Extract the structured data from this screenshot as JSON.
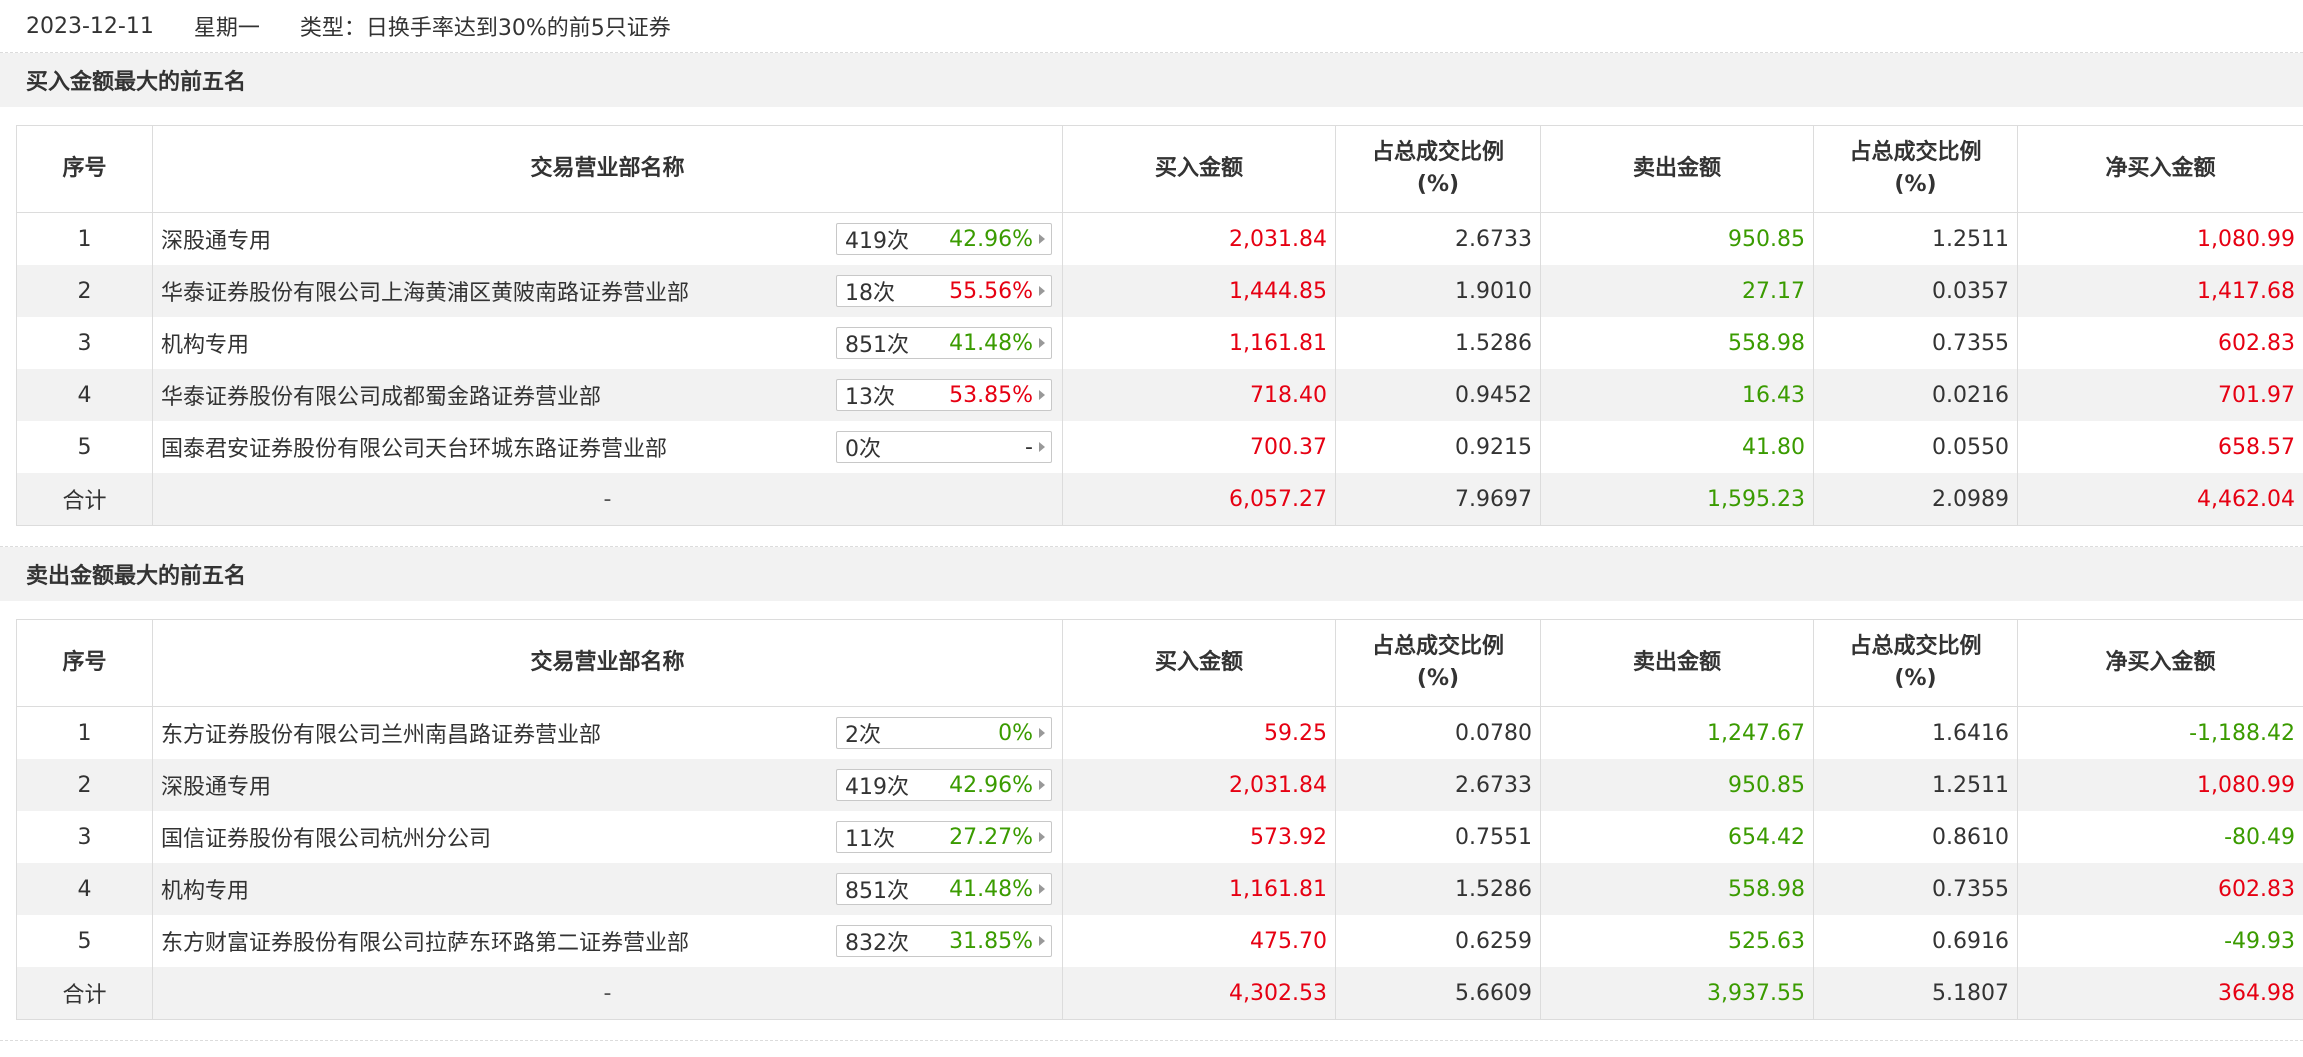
{
  "header": {
    "date": "2023-12-11",
    "weekday": "星期一",
    "type": "类型：日换手率达到30%的前5只证券"
  },
  "columns": {
    "idx": "序号",
    "name": "交易营业部名称",
    "buy": "买入金额",
    "buy_ratio_l1": "占总成交比例",
    "buy_ratio_l2": "(%)",
    "sell": "卖出金额",
    "sell_ratio_l1": "占总成交比例",
    "sell_ratio_l2": "(%)",
    "net": "净买入金额"
  },
  "buy_top5": {
    "title": "买入金额最大的前五名",
    "rows": [
      {
        "idx": "1",
        "name": "深股通专用",
        "count": "419次",
        "rate": "42.96%",
        "rate_color": "green",
        "buy": "2,031.84",
        "buy_ratio": "2.6733",
        "sell": "950.85",
        "sell_ratio": "1.2511",
        "net": "1,080.99",
        "net_color": "red"
      },
      {
        "idx": "2",
        "name": "华泰证券股份有限公司上海黄浦区黄陂南路证券营业部",
        "count": "18次",
        "rate": "55.56%",
        "rate_color": "red",
        "buy": "1,444.85",
        "buy_ratio": "1.9010",
        "sell": "27.17",
        "sell_ratio": "0.0357",
        "net": "1,417.68",
        "net_color": "red"
      },
      {
        "idx": "3",
        "name": "机构专用",
        "count": "851次",
        "rate": "41.48%",
        "rate_color": "green",
        "buy": "1,161.81",
        "buy_ratio": "1.5286",
        "sell": "558.98",
        "sell_ratio": "0.7355",
        "net": "602.83",
        "net_color": "red"
      },
      {
        "idx": "4",
        "name": "华泰证券股份有限公司成都蜀金路证券营业部",
        "count": "13次",
        "rate": "53.85%",
        "rate_color": "red",
        "buy": "718.40",
        "buy_ratio": "0.9452",
        "sell": "16.43",
        "sell_ratio": "0.0216",
        "net": "701.97",
        "net_color": "red"
      },
      {
        "idx": "5",
        "name": "国泰君安证券股份有限公司天台环城东路证券营业部",
        "count": "0次",
        "rate": "-",
        "rate_color": "gray",
        "buy": "700.37",
        "buy_ratio": "0.9215",
        "sell": "41.80",
        "sell_ratio": "0.0550",
        "net": "658.57",
        "net_color": "red"
      }
    ],
    "total": {
      "label": "合计",
      "name": "-",
      "buy": "6,057.27",
      "buy_ratio": "7.9697",
      "sell": "1,595.23",
      "sell_ratio": "2.0989",
      "net": "4,462.04",
      "net_color": "red"
    }
  },
  "sell_top5": {
    "title": "卖出金额最大的前五名",
    "rows": [
      {
        "idx": "1",
        "name": "东方证券股份有限公司兰州南昌路证券营业部",
        "count": "2次",
        "rate": "0%",
        "rate_color": "green",
        "buy": "59.25",
        "buy_ratio": "0.0780",
        "sell": "1,247.67",
        "sell_ratio": "1.6416",
        "net": "-1,188.42",
        "net_color": "green"
      },
      {
        "idx": "2",
        "name": "深股通专用",
        "count": "419次",
        "rate": "42.96%",
        "rate_color": "green",
        "buy": "2,031.84",
        "buy_ratio": "2.6733",
        "sell": "950.85",
        "sell_ratio": "1.2511",
        "net": "1,080.99",
        "net_color": "red"
      },
      {
        "idx": "3",
        "name": "国信证券股份有限公司杭州分公司",
        "count": "11次",
        "rate": "27.27%",
        "rate_color": "green",
        "buy": "573.92",
        "buy_ratio": "0.7551",
        "sell": "654.42",
        "sell_ratio": "0.8610",
        "net": "-80.49",
        "net_color": "green"
      },
      {
        "idx": "4",
        "name": "机构专用",
        "count": "851次",
        "rate": "41.48%",
        "rate_color": "green",
        "buy": "1,161.81",
        "buy_ratio": "1.5286",
        "sell": "558.98",
        "sell_ratio": "0.7355",
        "net": "602.83",
        "net_color": "red"
      },
      {
        "idx": "5",
        "name": "东方财富证券股份有限公司拉萨东环路第二证券营业部",
        "count": "832次",
        "rate": "31.85%",
        "rate_color": "green",
        "buy": "475.70",
        "buy_ratio": "0.6259",
        "sell": "525.63",
        "sell_ratio": "0.6916",
        "net": "-49.93",
        "net_color": "green"
      }
    ],
    "total": {
      "label": "合计",
      "name": "-",
      "buy": "4,302.53",
      "buy_ratio": "5.6609",
      "sell": "3,937.55",
      "sell_ratio": "5.1807",
      "net": "364.98",
      "net_color": "red"
    }
  }
}
